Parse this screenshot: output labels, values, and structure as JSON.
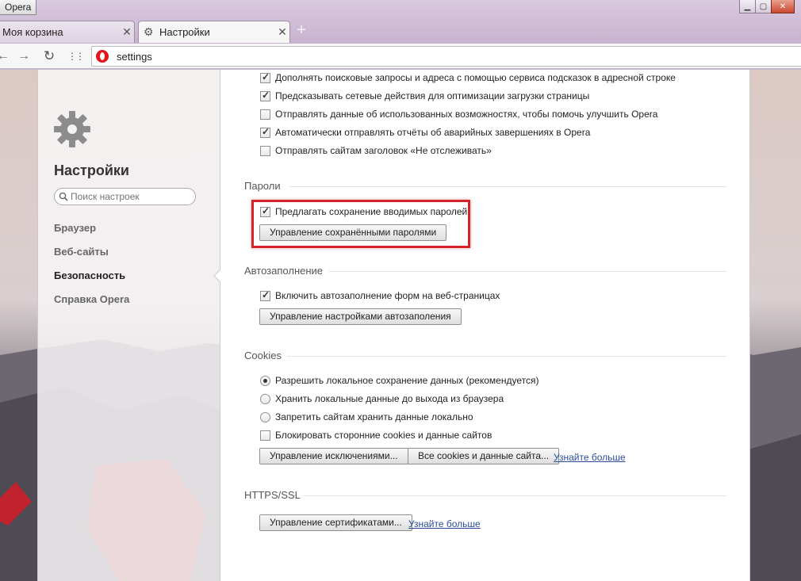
{
  "window": {
    "menu_label": "Opera",
    "min_glyph": "▁",
    "max_glyph": "▢",
    "close_glyph": "✕"
  },
  "tabs": [
    {
      "label": "Моя корзина",
      "close": "✕"
    },
    {
      "label": "Настройки",
      "close": "✕",
      "icon": "gear-icon"
    }
  ],
  "new_tab_glyph": "+",
  "toolbar": {
    "back_glyph": "←",
    "forward_glyph": "→",
    "reload_glyph": "↻",
    "speeddial_glyph": "⋮⋮",
    "address": "settings"
  },
  "sidebar": {
    "title": "Настройки",
    "search_placeholder": "Поиск настроек",
    "items": [
      {
        "label": "Браузер",
        "active": false
      },
      {
        "label": "Веб-сайты",
        "active": false
      },
      {
        "label": "Безопасность",
        "active": true
      },
      {
        "label": "Справка Opera",
        "active": false
      }
    ]
  },
  "privacy": {
    "options": [
      {
        "label": "Дополнять поисковые запросы и адреса с помощью сервиса подсказок в адресной строке",
        "checked": true
      },
      {
        "label": "Предсказывать сетевые действия для оптимизации загрузки страницы",
        "checked": true
      },
      {
        "label": "Отправлять данные об использованных возможностях, чтобы помочь улучшить Opera",
        "checked": false
      },
      {
        "label": "Автоматически отправлять отчёты об аварийных завершениях в Opera",
        "checked": true
      },
      {
        "label": "Отправлять сайтам заголовок «Не отслеживать»",
        "checked": false
      }
    ]
  },
  "passwords": {
    "title": "Пароли",
    "offer_save_label": "Предлагать сохранение вводимых паролей",
    "offer_save_checked": true,
    "manage_button": "Управление сохранёнными паролями",
    "highlight_color": "#d3232a"
  },
  "autofill": {
    "title": "Автозаполнение",
    "enable_label": "Включить автозаполнение форм на веб-страницах",
    "enable_checked": true,
    "manage_button": "Управление настройками автозаполения"
  },
  "cookies": {
    "title": "Cookies",
    "options": [
      {
        "label": "Разрешить локальное сохранение данных (рекомендуется)",
        "selected": true
      },
      {
        "label": "Хранить локальные данные до выхода из браузера",
        "selected": false
      },
      {
        "label": "Запретить сайтам хранить данные локально",
        "selected": false
      }
    ],
    "block_third_party_label": "Блокировать сторонние cookies и данные сайтов",
    "block_third_party_checked": false,
    "exceptions_button": "Управление исключениями...",
    "all_cookies_button": "Все cookies и данные сайта...",
    "learn_more": "Узнайте больше"
  },
  "https": {
    "title": "HTTPS/SSL",
    "certificates_button": "Управление сертификатами...",
    "learn_more": "Узнайте больше"
  }
}
